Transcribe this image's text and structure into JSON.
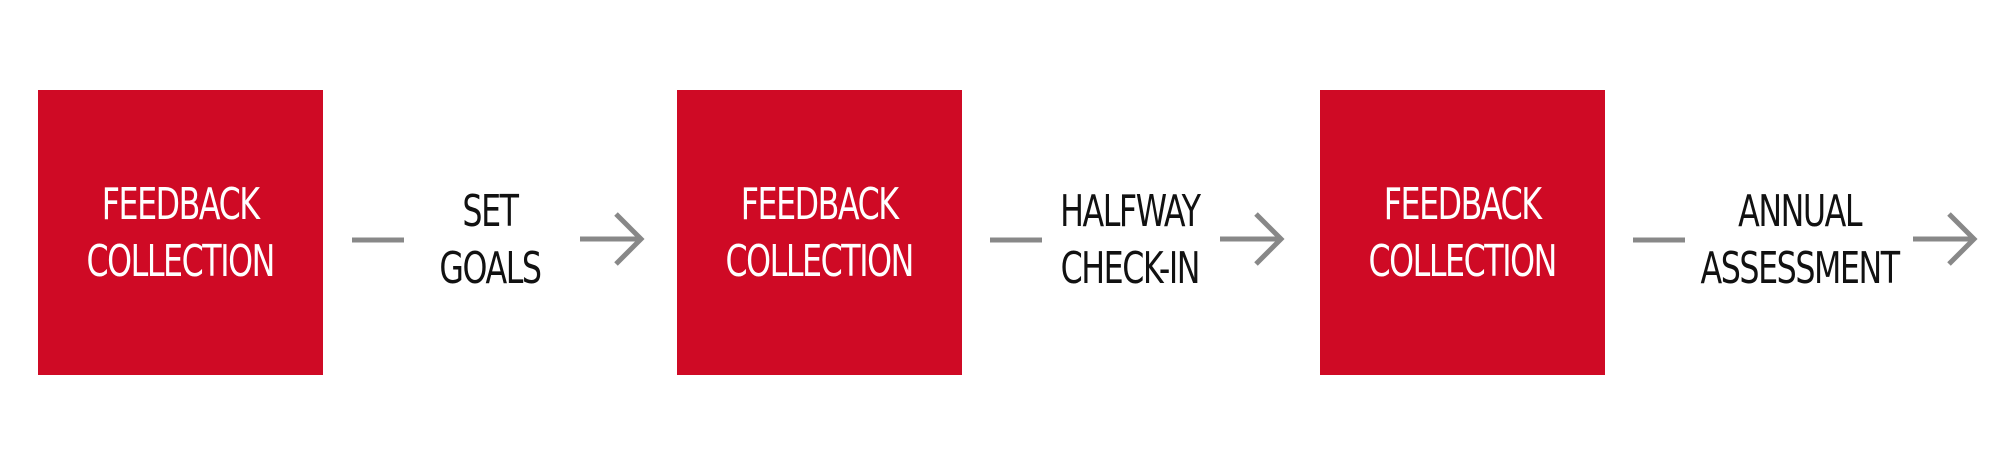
{
  "colors": {
    "box_fill": "#cf0a25",
    "connector": "#888888",
    "box_text": "#ffffff",
    "step_text": "#111111"
  },
  "boxes": [
    {
      "label": "FEEDBACK\nCOLLECTION"
    },
    {
      "label": "FEEDBACK\nCOLLECTION"
    },
    {
      "label": "FEEDBACK\nCOLLECTION"
    }
  ],
  "steps": [
    {
      "label": "SET GOALS"
    },
    {
      "label": "HALFWAY\nCHECK-IN"
    },
    {
      "label": "ANNUAL\nASSESSMENT"
    }
  ]
}
